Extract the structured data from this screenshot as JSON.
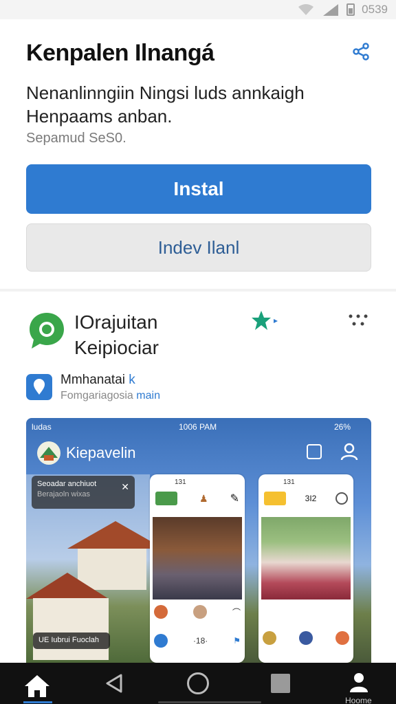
{
  "status_bar": {
    "time": "0539"
  },
  "app": {
    "title": "Kenpalen Ilnangá",
    "description_line1": "Nenanlinngiin Ningsi luds annkaigh",
    "description_line2": "Henpaams anban.",
    "size_text": "Sepamud SeS0.",
    "install_label": "Instal",
    "secondary_label": "Indev Ilanl"
  },
  "listing": {
    "name_line1": "IOrajuitan",
    "name_line2": "Keipiociar",
    "developer_name": "Mmhanatai",
    "developer_suffix": "k",
    "developer_sub_prefix": "Fomgariagosia",
    "developer_sub_link": "main"
  },
  "screenshot": {
    "status_left": "ludas",
    "status_time": "1006 PAM",
    "status_right": "26%",
    "header_title": "Kiepavelin",
    "notification_title": "Seoadar anchiuot",
    "notification_sub": "Berajaoln wixas",
    "chip_label": "UE Iubrui Fuoclah",
    "phone1": {
      "time": "131",
      "row_value": "·18·"
    },
    "phone2": {
      "time": "131",
      "top_value": "3I2"
    }
  },
  "nav": {
    "user_label": "Hoome"
  },
  "colors": {
    "accent": "#2f7bd1",
    "listing_icon": "#3aa64a",
    "star": "#1aa07a"
  }
}
